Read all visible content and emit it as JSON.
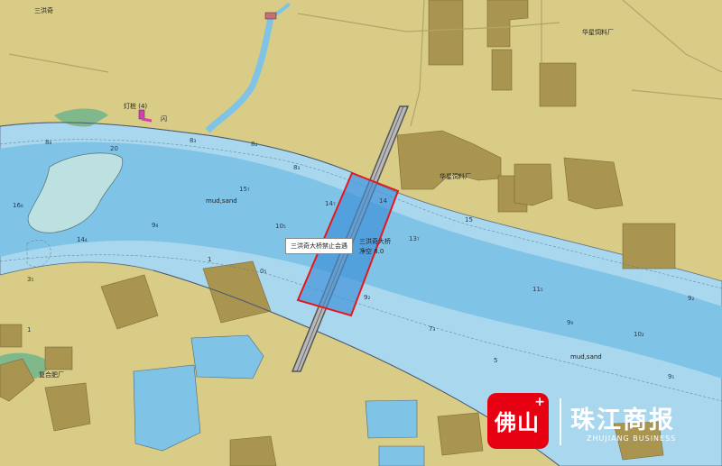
{
  "place_labels": {
    "village": "三洪奇",
    "factory_top": "华星饲料厂",
    "factory_mid": "华星饲料厂",
    "fertilizer": "复合肥厂",
    "light_beacon": "灯桩 (4)",
    "beacon_code": "闪"
  },
  "seabed_labels": [
    "mud,sand",
    "mud,sand"
  ],
  "depth_soundings": [
    "8₈",
    "8₃",
    "8₃",
    "8₄",
    "20",
    "15₇",
    "14₇",
    "14",
    "15",
    "13₇",
    "10₅",
    "9₈",
    "16₈",
    "14₄",
    "3₅",
    "1",
    "0₅",
    "9₂",
    "11₅",
    "9₉",
    "10₂",
    "9₁",
    "9₂",
    "5",
    "7₃",
    "1"
  ],
  "callouts": {
    "no_anchor_zone": "三洪奇大桥禁止会遇",
    "bridge_name": "三洪奇大桥",
    "clearance": "净空 8.0"
  },
  "watermark": {
    "logo_text": "佛山",
    "logo_plus": "+",
    "brand": "珠江商报",
    "brand_sub": "ZHUJIANG BUSINESS"
  },
  "colors": {
    "land": "#d8cc86",
    "river": "#a8d7ee",
    "deep_water": "#7fc3e6",
    "building": "#a99450",
    "restricted_border": "#e8151b",
    "restricted_fill": "#3b8fd8"
  }
}
